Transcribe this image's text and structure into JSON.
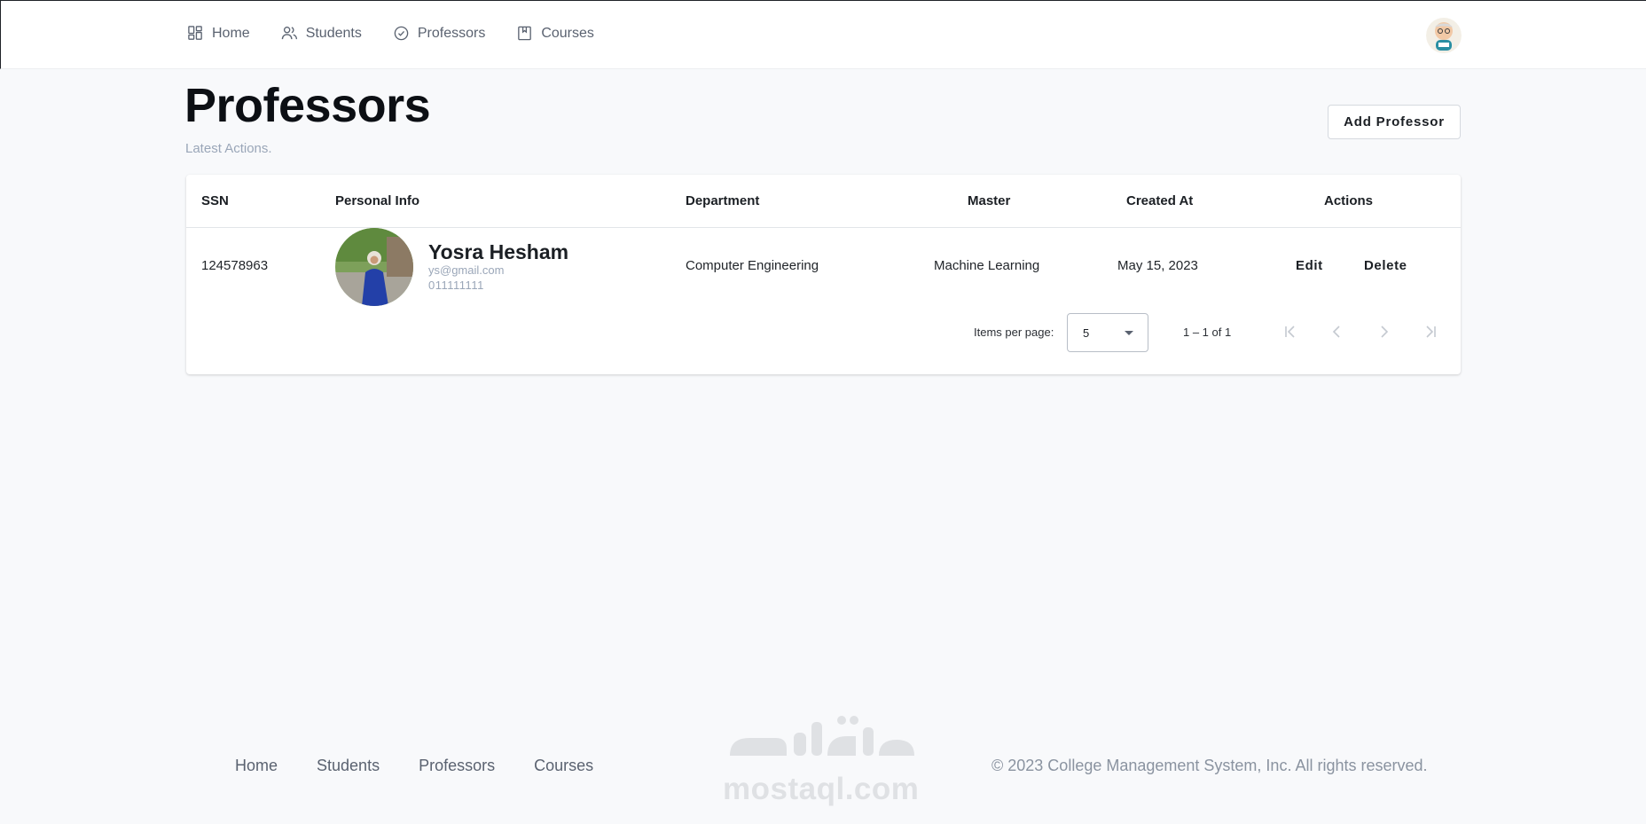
{
  "nav": {
    "items": [
      {
        "label": "Home",
        "icon": "dashboard-icon"
      },
      {
        "label": "Students",
        "icon": "users-icon"
      },
      {
        "label": "Professors",
        "icon": "check-circle-icon"
      },
      {
        "label": "Courses",
        "icon": "bookmark-icon"
      }
    ]
  },
  "page": {
    "title": "Professors",
    "subtitle": "Latest Actions.",
    "add_button": "Add Professor"
  },
  "table": {
    "columns": [
      "SSN",
      "Personal Info",
      "Department",
      "Master",
      "Created At",
      "Actions"
    ],
    "rows": [
      {
        "ssn": "124578963",
        "name": "Yosra Hesham",
        "email": "ys@gmail.com",
        "phone": "011111111",
        "department": "Computer Engineering",
        "master": "Machine Learning",
        "created_at": "May 15, 2023",
        "edit_label": "Edit",
        "delete_label": "Delete"
      }
    ]
  },
  "paginator": {
    "items_per_page_label": "Items per page:",
    "page_size": "5",
    "range_label": "1 – 1 of 1"
  },
  "footer": {
    "links": [
      "Home",
      "Students",
      "Professors",
      "Courses"
    ],
    "copyright": "© 2023 College Management System, Inc. All rights reserved."
  },
  "watermark": {
    "arabic": "مستقل",
    "latin": "mostaql.com"
  },
  "colors": {
    "background": "#f8f9fb",
    "muted_text": "#9aa6b8",
    "heading": "#0c0f14"
  }
}
